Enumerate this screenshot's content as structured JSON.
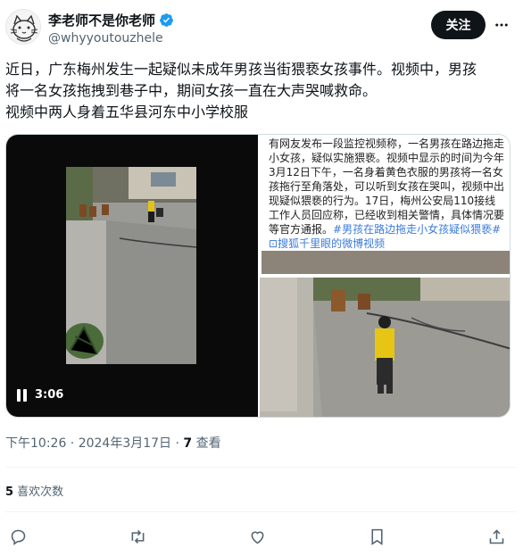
{
  "author": {
    "display_name": "李老师不是你老师",
    "handle": "@whyyoutouzhele",
    "verified_icon": "verified-badge-icon",
    "verified_color": "#1d9bf0"
  },
  "header": {
    "follow_label": "关注",
    "more_icon": "more-dots-icon"
  },
  "tweet": {
    "lines": [
      "近日，广东梅州发生一起疑似未成年男孩当街猥亵女孩事件。视频中，男孩",
      "将一名女孩拖拽到巷子中，期间女孩一直在大声哭喊救命。",
      "视频中两人身着五华县河东中小学校服"
    ]
  },
  "media": {
    "video_duration": "3:06",
    "video_state_icon": "pause-icon",
    "screenshot": {
      "text_plain": "有网友发布一段监控视频称，一名男孩在路边拖走小女孩，疑似实施猥亵。视频中显示的时间为今年3月12日下午，一名身着黄色衣服的男孩将一名女孩拖行至角落处，可以听到女孩在哭叫，视频中出现疑似猥亵的行为。17日，梅州公安局110接线工作人员回应称，已经收到相关警情，具体情况要等官方通报。",
      "text_link": "#男孩在路边拖走小女孩疑似猥亵#",
      "text_link2": "搜狐千里眼的微博视频"
    }
  },
  "meta": {
    "time": "下午10:26 · 2024年3月17日 · ",
    "views_count": "7",
    "views_label": " 查看"
  },
  "favorites": {
    "count": "5",
    "label": " 喜欢次数"
  },
  "actions": {
    "reply_icon": "reply-icon",
    "retweet_icon": "retweet-icon",
    "like_icon": "heart-icon",
    "bookmark_icon": "bookmark-icon",
    "share_icon": "share-icon"
  },
  "colors": {
    "text": "#0f1419",
    "secondary": "#536471",
    "accent": "#1d9bf0",
    "link_in_image": "#3b7bdb"
  }
}
